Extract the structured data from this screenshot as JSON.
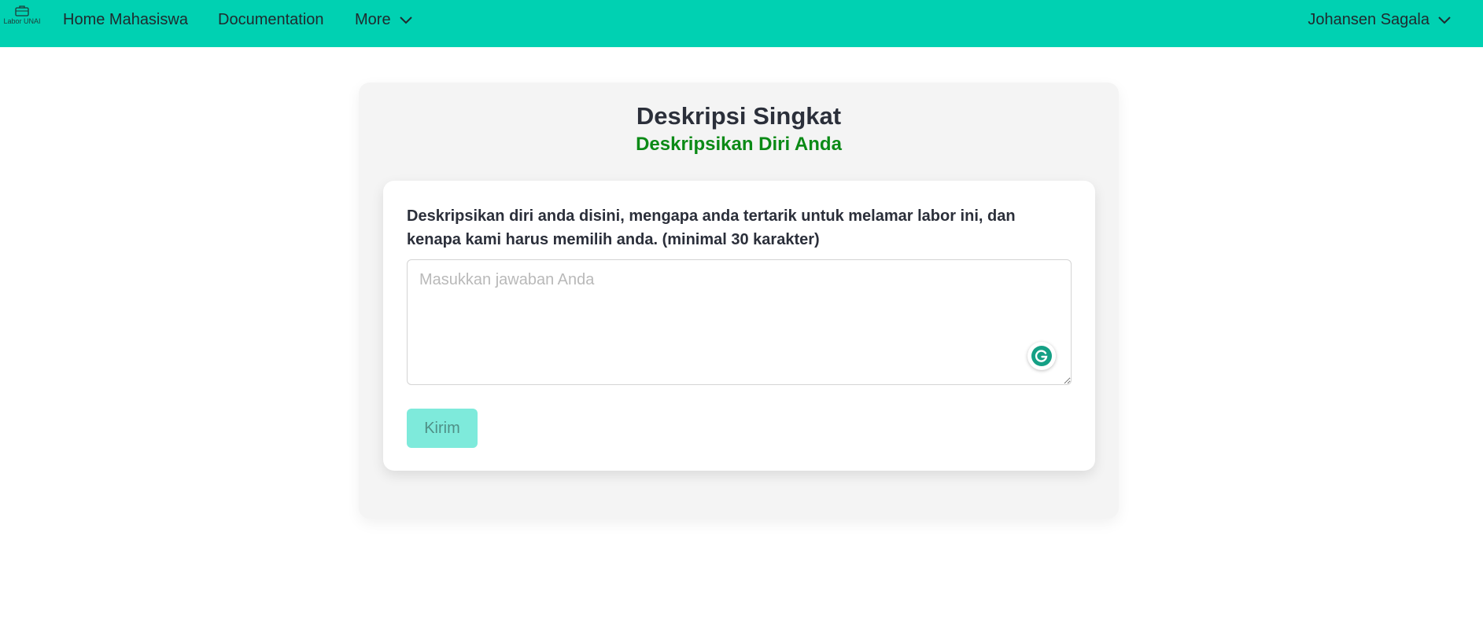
{
  "navbar": {
    "logo_text": "Labor UNAI",
    "home_label": "Home Mahasiswa",
    "docs_label": "Documentation",
    "more_label": "More",
    "user_label": "Johansen Sagala",
    "bg_color": "#00d1b2"
  },
  "form": {
    "title": "Deskripsi Singkat",
    "subtitle": "Deskripsikan Diri Anda",
    "question": "Deskripsikan diri anda disini, mengapa anda tertarik untuk melamar labor ini, dan kenapa kami harus memilih anda. (minimal 30 karakter)",
    "answer_value": "",
    "answer_placeholder": "Masukkan jawaban Anda",
    "submit_label": "Kirim",
    "subtitle_color": "#0b8a16",
    "submit_color": "#7eeadb"
  },
  "icons": {
    "logo": "briefcase-icon",
    "more_chevron": "chevron-down-icon",
    "user_chevron": "chevron-down-icon",
    "grammarly": "grammarly-icon"
  }
}
